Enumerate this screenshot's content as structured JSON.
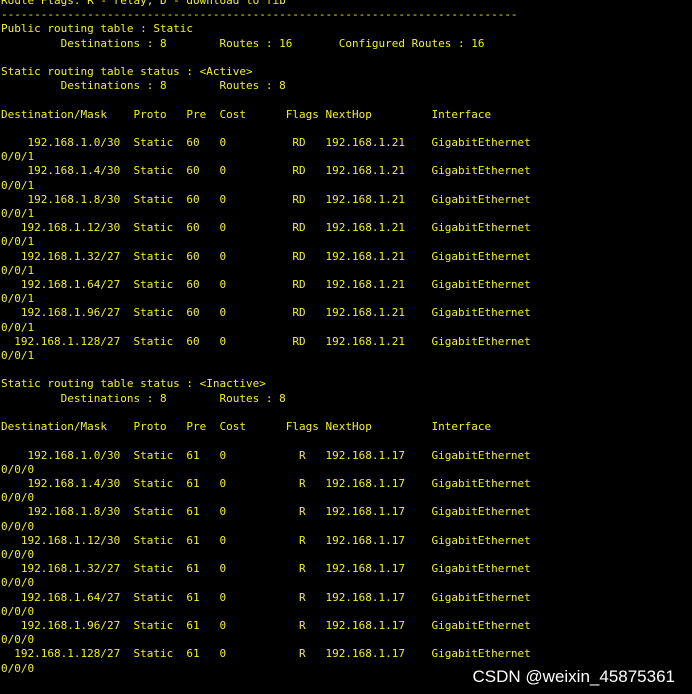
{
  "terminal": {
    "header": {
      "flags_line": "Route Flags: R - relay, D - download to fib",
      "separator": "------------------------------------------------------------------------------",
      "public_table_line": "Public routing table : Static",
      "public_counts_line": "         Destinations : 8        Routes : 16       Configured Routes : 16"
    },
    "active": {
      "status_line": "Static routing table status : <Active>",
      "counts_line": "         Destinations : 8        Routes : 8",
      "column_header": "Destination/Mask    Proto   Pre  Cost      Flags NextHop         Interface",
      "rows": [
        {
          "main": "    192.168.1.0/30  Static  60   0          RD   192.168.1.21    GigabitEthernet",
          "cont": "0/0/1"
        },
        {
          "main": "    192.168.1.4/30  Static  60   0          RD   192.168.1.21    GigabitEthernet",
          "cont": "0/0/1"
        },
        {
          "main": "    192.168.1.8/30  Static  60   0          RD   192.168.1.21    GigabitEthernet",
          "cont": "0/0/1"
        },
        {
          "main": "   192.168.1.12/30  Static  60   0          RD   192.168.1.21    GigabitEthernet",
          "cont": "0/0/1"
        },
        {
          "main": "   192.168.1.32/27  Static  60   0          RD   192.168.1.21    GigabitEthernet",
          "cont": "0/0/1"
        },
        {
          "main": "   192.168.1.64/27  Static  60   0          RD   192.168.1.21    GigabitEthernet",
          "cont": "0/0/1"
        },
        {
          "main": "   192.168.1.96/27  Static  60   0          RD   192.168.1.21    GigabitEthernet",
          "cont": "0/0/1"
        },
        {
          "main": "  192.168.1.128/27  Static  60   0          RD   192.168.1.21    GigabitEthernet",
          "cont": "0/0/1"
        }
      ]
    },
    "inactive": {
      "status_line": "Static routing table status : <Inactive>",
      "counts_line": "         Destinations : 8        Routes : 8",
      "column_header": "Destination/Mask    Proto   Pre  Cost      Flags NextHop         Interface",
      "rows": [
        {
          "main": "    192.168.1.0/30  Static  61   0           R   192.168.1.17    GigabitEthernet",
          "cont": "0/0/0"
        },
        {
          "main": "    192.168.1.4/30  Static  61   0           R   192.168.1.17    GigabitEthernet",
          "cont": "0/0/0"
        },
        {
          "main": "    192.168.1.8/30  Static  61   0           R   192.168.1.17    GigabitEthernet",
          "cont": "0/0/0"
        },
        {
          "main": "   192.168.1.12/30  Static  61   0           R   192.168.1.17    GigabitEthernet",
          "cont": "0/0/0"
        },
        {
          "main": "   192.168.1.32/27  Static  61   0           R   192.168.1.17    GigabitEthernet",
          "cont": "0/0/0"
        },
        {
          "main": "   192.168.1.64/27  Static  61   0           R   192.168.1.17    GigabitEthernet",
          "cont": "0/0/0"
        },
        {
          "main": "   192.168.1.96/27  Static  61   0           R   192.168.1.17    GigabitEthernet",
          "cont": "0/0/0"
        },
        {
          "main": "  192.168.1.128/27  Static  61   0           R   192.168.1.17    GigabitEthernet",
          "cont": "0/0/0"
        }
      ]
    }
  },
  "watermark": "CSDN @weixin_45875361",
  "colors": {
    "background": "#000000",
    "text": "#f2f21a",
    "watermark": "#ffffff"
  }
}
